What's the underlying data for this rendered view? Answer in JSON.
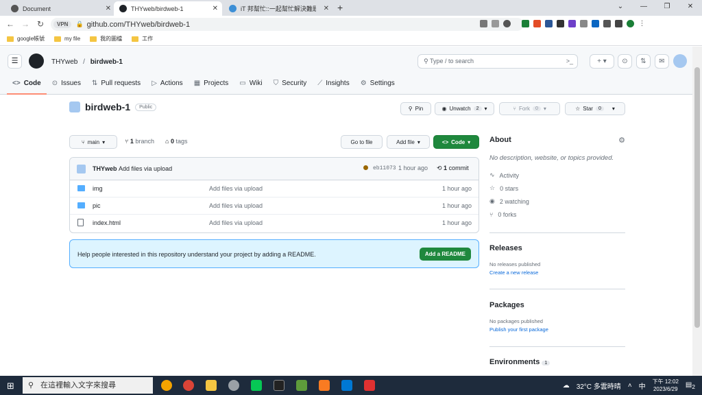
{
  "browser": {
    "tabs": [
      {
        "title": "Document"
      },
      {
        "title": "THYweb/birdweb-1"
      },
      {
        "title": "iT 邦幫忙::一起幫忙解決難題，拯"
      }
    ],
    "url": "github.com/THYweb/birdweb-1",
    "vpn": "VPN",
    "bookmarks": [
      "google帳號",
      "my file",
      "我的圖檔",
      "工作"
    ]
  },
  "header": {
    "owner": "THYweb",
    "repo": "birdweb-1",
    "search_placeholder": "Type / to search"
  },
  "repo_tabs": [
    {
      "label": "Code",
      "icon": "code-icon"
    },
    {
      "label": "Issues",
      "icon": "issue-icon"
    },
    {
      "label": "Pull requests",
      "icon": "pull-request-icon"
    },
    {
      "label": "Actions",
      "icon": "play-icon"
    },
    {
      "label": "Projects",
      "icon": "table-icon"
    },
    {
      "label": "Wiki",
      "icon": "book-icon"
    },
    {
      "label": "Security",
      "icon": "shield-icon"
    },
    {
      "label": "Insights",
      "icon": "graph-icon"
    },
    {
      "label": "Settings",
      "icon": "gear-icon"
    }
  ],
  "repo": {
    "name": "birdweb-1",
    "visibility": "Public",
    "pin": "Pin",
    "unwatch": "Unwatch",
    "watch_count": "2",
    "fork": "Fork",
    "fork_count": "0",
    "star": "Star",
    "star_count": "0"
  },
  "controls": {
    "branch": "main",
    "branch_count": "1",
    "branch_label": "branch",
    "tag_count": "0",
    "tag_label": "tags",
    "go_to_file": "Go to file",
    "add_file": "Add file",
    "code": "Code"
  },
  "commit": {
    "author": "THYweb",
    "message": "Add files via upload",
    "hash": "eb11073",
    "age": "1 hour ago",
    "count": "1",
    "count_label": "commit"
  },
  "files": [
    {
      "name": "img",
      "type": "folder",
      "message": "Add files via upload",
      "age": "1 hour ago"
    },
    {
      "name": "pic",
      "type": "folder",
      "message": "Add files via upload",
      "age": "1 hour ago"
    },
    {
      "name": "index.html",
      "type": "file",
      "message": "Add files via upload",
      "age": "1 hour ago"
    }
  ],
  "readme": {
    "text": "Help people interested in this repository understand your project by adding a README.",
    "button": "Add a README"
  },
  "about": {
    "title": "About",
    "description": "No description, website, or topics provided.",
    "activity": "Activity",
    "stars": "0 stars",
    "watching": "2 watching",
    "forks": "0 forks"
  },
  "releases": {
    "title": "Releases",
    "none": "No releases published",
    "link": "Create a new release"
  },
  "packages": {
    "title": "Packages",
    "none": "No packages published",
    "link": "Publish your first package"
  },
  "environments": {
    "title": "Environments",
    "count": "1"
  },
  "taskbar": {
    "search": "在這裡輸入文字來搜尋",
    "weather": "32°C 多雲時晴",
    "ime": "中",
    "time": "下午 12:02",
    "date": "2023/6/29",
    "notif": "2"
  },
  "colors": {
    "green": "#1f883d",
    "link": "#0969da",
    "folder": "#54aeff"
  }
}
